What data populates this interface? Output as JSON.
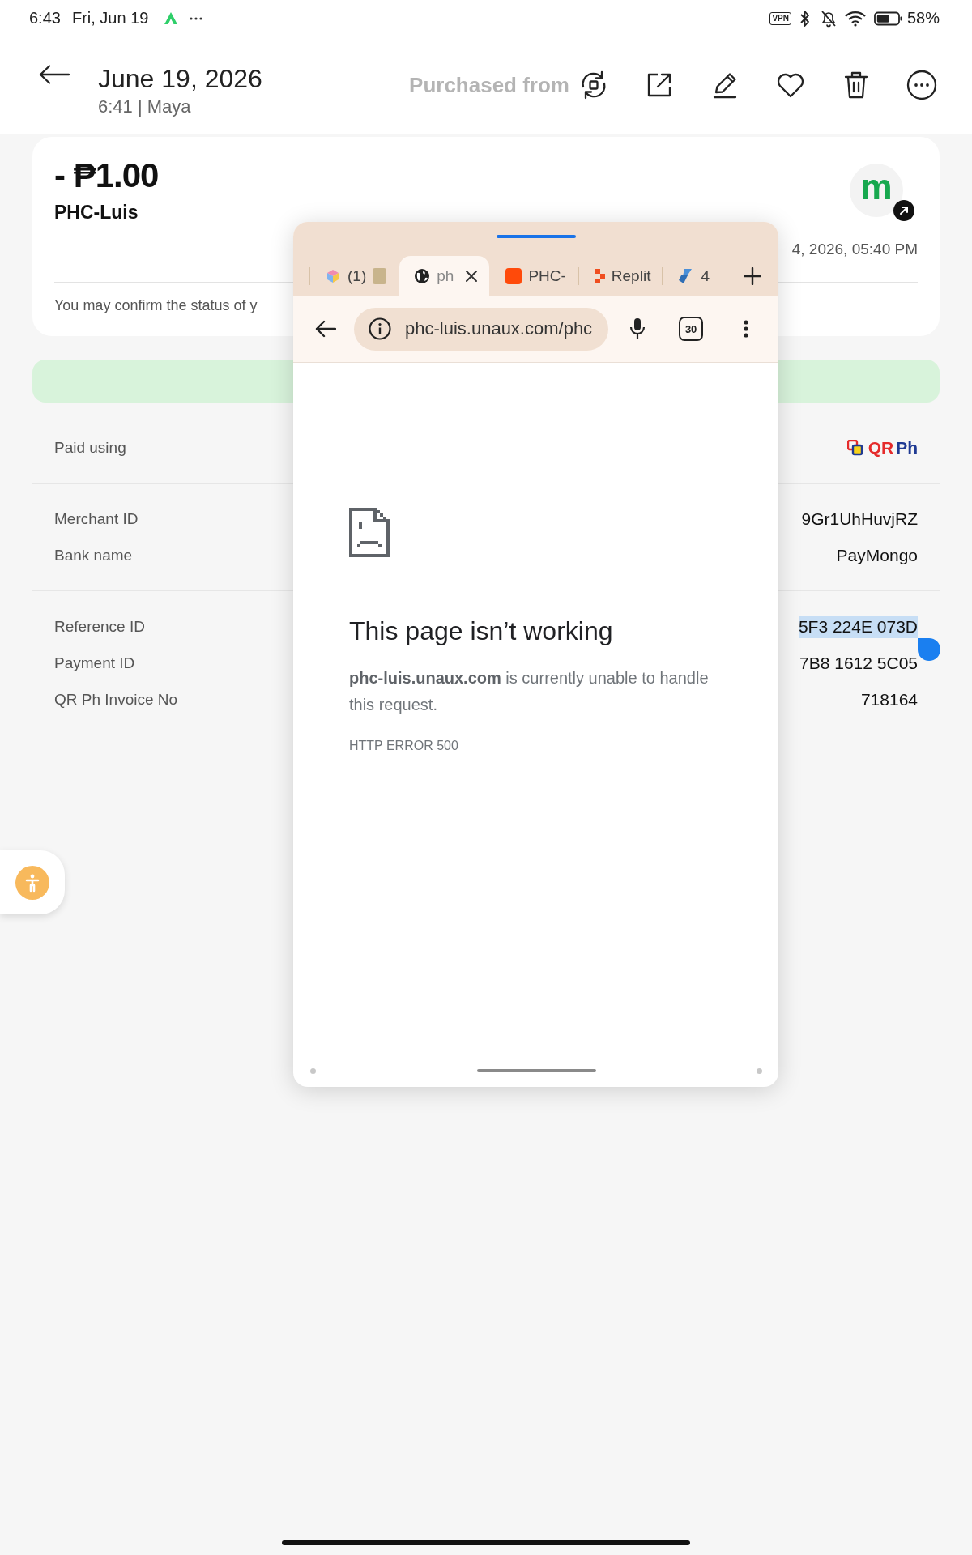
{
  "status_bar": {
    "time": "6:43",
    "date": "Fri, Jun 19",
    "vpn_label": "VPN",
    "battery": "58%"
  },
  "header": {
    "title": "June 19, 2026",
    "subtitle": "6:41 | Maya",
    "faded_title": "Purchased from"
  },
  "transaction": {
    "amount": "- ₱1.00",
    "merchant": "PHC-Luis",
    "logo_letter": "m",
    "date": "4, 2026, 05:40 PM",
    "note": "You may confirm the status of y"
  },
  "details": [
    {
      "rows": [
        {
          "kind": "logo",
          "label": "Paid using",
          "logo_words": [
            "QR",
            "Ph"
          ],
          "highlighted": false
        }
      ]
    },
    {
      "rows": [
        {
          "kind": "text",
          "label": "Merchant ID",
          "value": "9Gr1UhHuvjRZ",
          "highlighted": false
        },
        {
          "kind": "text",
          "label": "Bank name",
          "value": "PayMongo",
          "highlighted": false
        }
      ]
    },
    {
      "rows": [
        {
          "kind": "text",
          "label": "Reference ID",
          "value": "5F3 224E 073D",
          "highlighted": true
        },
        {
          "kind": "text",
          "label": "Payment ID",
          "value": "7B8 1612 5C05",
          "highlighted": false
        },
        {
          "kind": "text",
          "label": "QR Ph Invoice No",
          "value": "718164",
          "highlighted": false
        }
      ]
    }
  ],
  "browser_popup": {
    "tabs": [
      {
        "label": "(1)",
        "selected": false
      },
      {
        "label": "ph",
        "selected": true
      },
      {
        "label": "PHC-",
        "selected": false
      },
      {
        "label": "Replit",
        "selected": false
      },
      {
        "label": "4",
        "selected": false
      }
    ],
    "url": "phc-luis.unaux.com/phc",
    "tab_count": "30",
    "error": {
      "title": "This page isn’t working",
      "message": "**phc-luis.unaux.com** is currently unable to handle this request.",
      "code": "HTTP ERROR 500"
    }
  }
}
